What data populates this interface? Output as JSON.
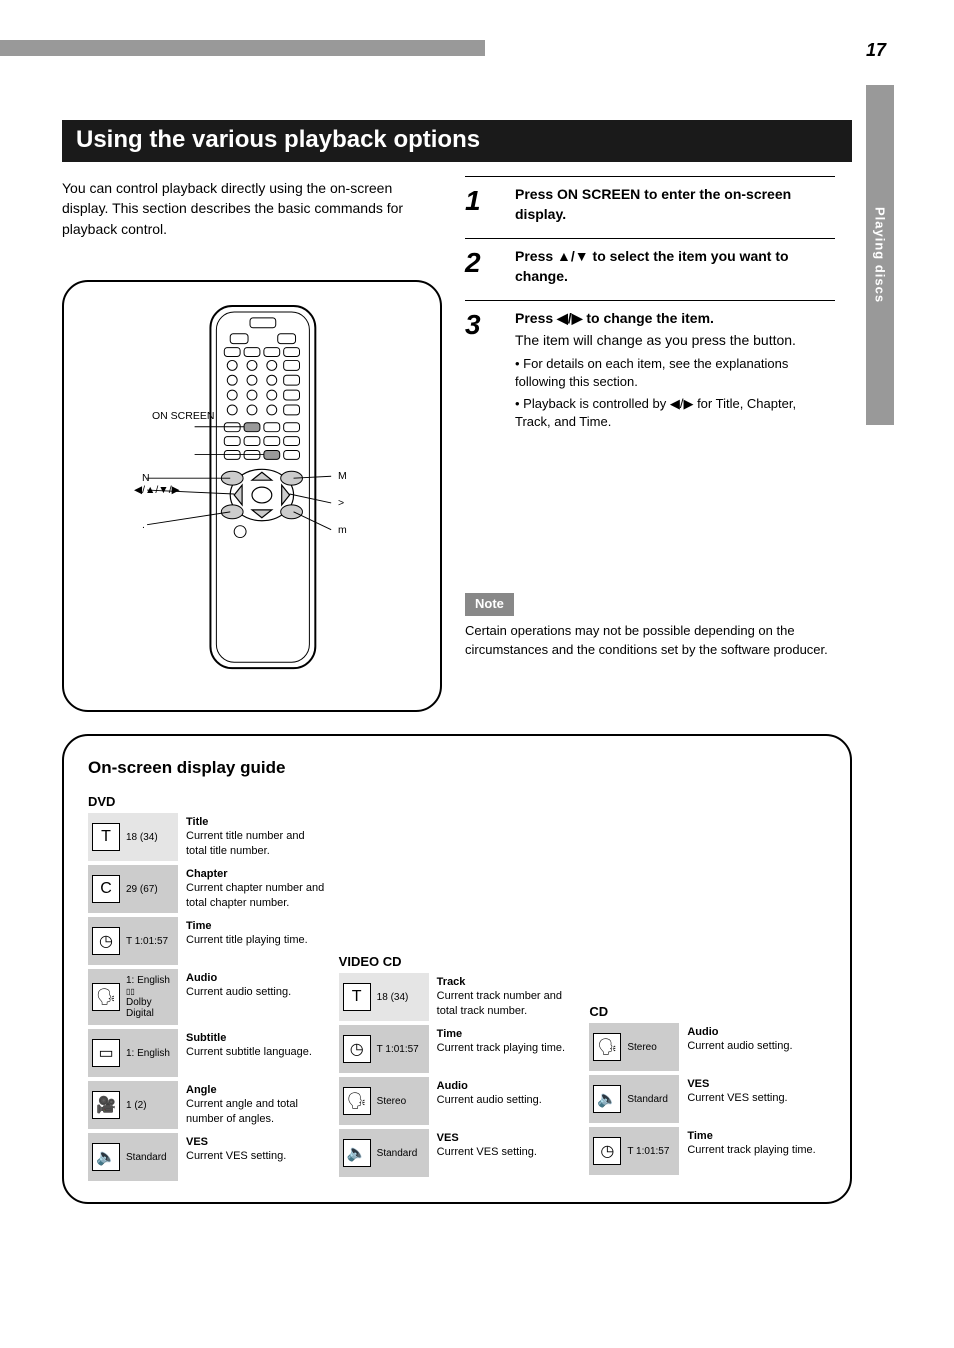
{
  "page_number": "17",
  "side_tab": "Playing discs",
  "title": "Using the various playback options",
  "intro": "You can control playback directly using the on-screen display. This section describes the basic commands for playback control.",
  "remote": {
    "labels": {
      "play": "N",
      "on_screen": "ON SCREEN",
      "prev": ".",
      "ff": "M",
      "next": ">",
      "rew": "m"
    }
  },
  "steps": [
    {
      "num": "1",
      "main": "Press ON SCREEN to enter the on-screen display.",
      "sub": "",
      "bullets": []
    },
    {
      "num": "2",
      "main": "Press ▲/▼ to select the item you want to change.",
      "sub": "",
      "bullets": []
    },
    {
      "num": "3",
      "main": "Press ◀/▶ to change the item.",
      "sub": "The item will change as you press the button.",
      "bullets": [
        "For details on each item, see the explanations following this section.",
        "Playback is controlled by ◀/▶ for Title, Chapter, Track, and Time."
      ]
    }
  ],
  "note": {
    "label": "Note",
    "text": "Certain operations may not be possible depending on the circumstances and the conditions set by the software producer."
  },
  "guide": {
    "title": "On-screen display guide",
    "dvd_label": "DVD",
    "vcd_label": "VIDEO CD",
    "cd_label": "CD",
    "rows_dvd": [
      {
        "icon": "T",
        "val": "18 (34)",
        "dt": "Title",
        "dd": "Current title number and total title number."
      },
      {
        "icon": "C",
        "val": "29 (67)",
        "dt": "Chapter",
        "dd": "Current chapter number and total chapter number."
      },
      {
        "icon": "clock",
        "val": "T 1:01:57",
        "dt": "Time",
        "dd": "Current title playing time."
      },
      {
        "icon": "audio",
        "val": "1: English",
        "val2": "Dolby Digital",
        "dt": "Audio",
        "dd": "Current audio setting."
      },
      {
        "icon": "subtitle",
        "val": "1: English",
        "dt": "Subtitle",
        "dd": "Current subtitle language."
      },
      {
        "icon": "angle",
        "val": "1 (2)",
        "dt": "Angle",
        "dd": "Current angle and total number of angles."
      },
      {
        "icon": "sound",
        "val": "Standard",
        "dt": "VES",
        "dd": "Current VES setting."
      }
    ],
    "rows_vcd": [
      {
        "icon": "T",
        "val": "18 (34)",
        "dt": "Track",
        "dd": "Current track number and total track number."
      },
      {
        "icon": "clock",
        "val": "T 1:01:57",
        "dt": "Time",
        "dd": "Current track playing time."
      },
      {
        "icon": "audio",
        "val": "Stereo",
        "dt": "Audio",
        "dd": "Current audio setting."
      },
      {
        "icon": "sound",
        "val": "Standard",
        "dt": "VES",
        "dd": "Current VES setting."
      }
    ],
    "rows_cd": [
      {
        "icon": "audio",
        "val": "Stereo",
        "dt": "Audio",
        "dd": "Current audio setting."
      },
      {
        "icon": "sound",
        "val": "Standard",
        "dt": "VES",
        "dd": "Current VES setting."
      },
      {
        "icon": "clock",
        "val": "T 1:01:57",
        "dt": "Time",
        "dd": "Current track playing time."
      }
    ]
  }
}
